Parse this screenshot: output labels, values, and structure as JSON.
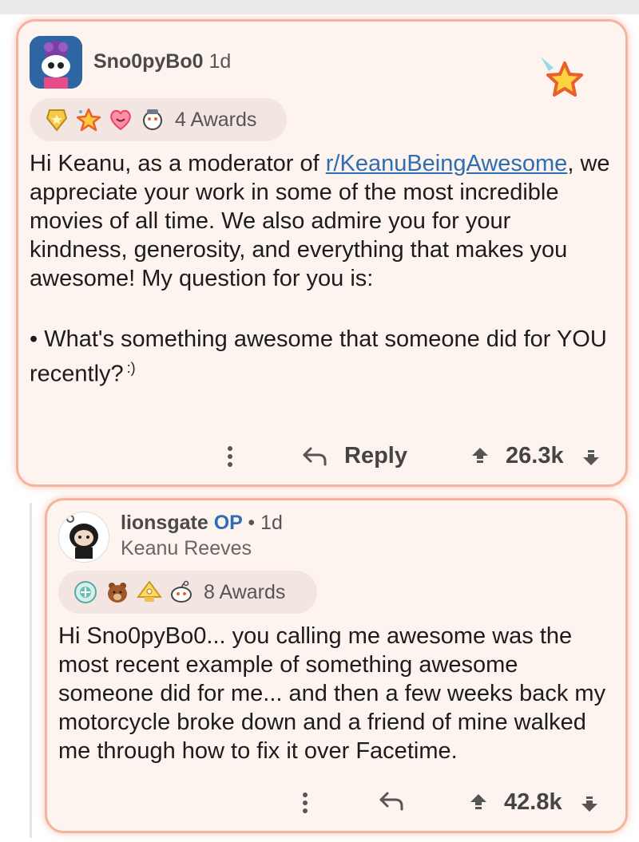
{
  "comment1": {
    "username": "Sno0pyBo0",
    "age": "1d",
    "awards_count_label": "4 Awards",
    "awards": [
      "gold-award-icon",
      "star-struck-award-icon",
      "wholesome-award-icon",
      "helpful-award-icon"
    ],
    "body_line1_prefix": "Hi Keanu, as a moderator of ",
    "body_link": "r/KeanuBeingAwesome",
    "body_line1_suffix": ",",
    "body_rest": "we appreciate your work in some of the most incredible movies of all time. We also admire you for your kindness, generosity, and everything that makes you awesome! My question for you is:",
    "bullet": "•",
    "question": "What's something awesome that someone did for YOU recently?",
    "smiley": ":)",
    "reply_label": "Reply",
    "score": "26.3k"
  },
  "comment2": {
    "username": "lionsgate",
    "op_label": "OP",
    "separator": "•",
    "age": "1d",
    "flair": "Keanu Reeves",
    "awards_count_label": "8 Awards",
    "awards": [
      "platinum-award-icon",
      "bear-award-icon",
      "bless-up-award-icon",
      "snoo-award-icon"
    ],
    "body": "Hi Sno0pyBo0... you calling me awesome was the most recent example of something awesome someone did for me... and then a few weeks back my motorcycle broke down and a friend of mine walked me through how to fix it over Facetime.",
    "score": "42.8k"
  },
  "colors": {
    "card_bg": "#fdf3ef",
    "card_border": "#f5b49f",
    "link": "#2f6db3",
    "op": "#2f6db3"
  }
}
